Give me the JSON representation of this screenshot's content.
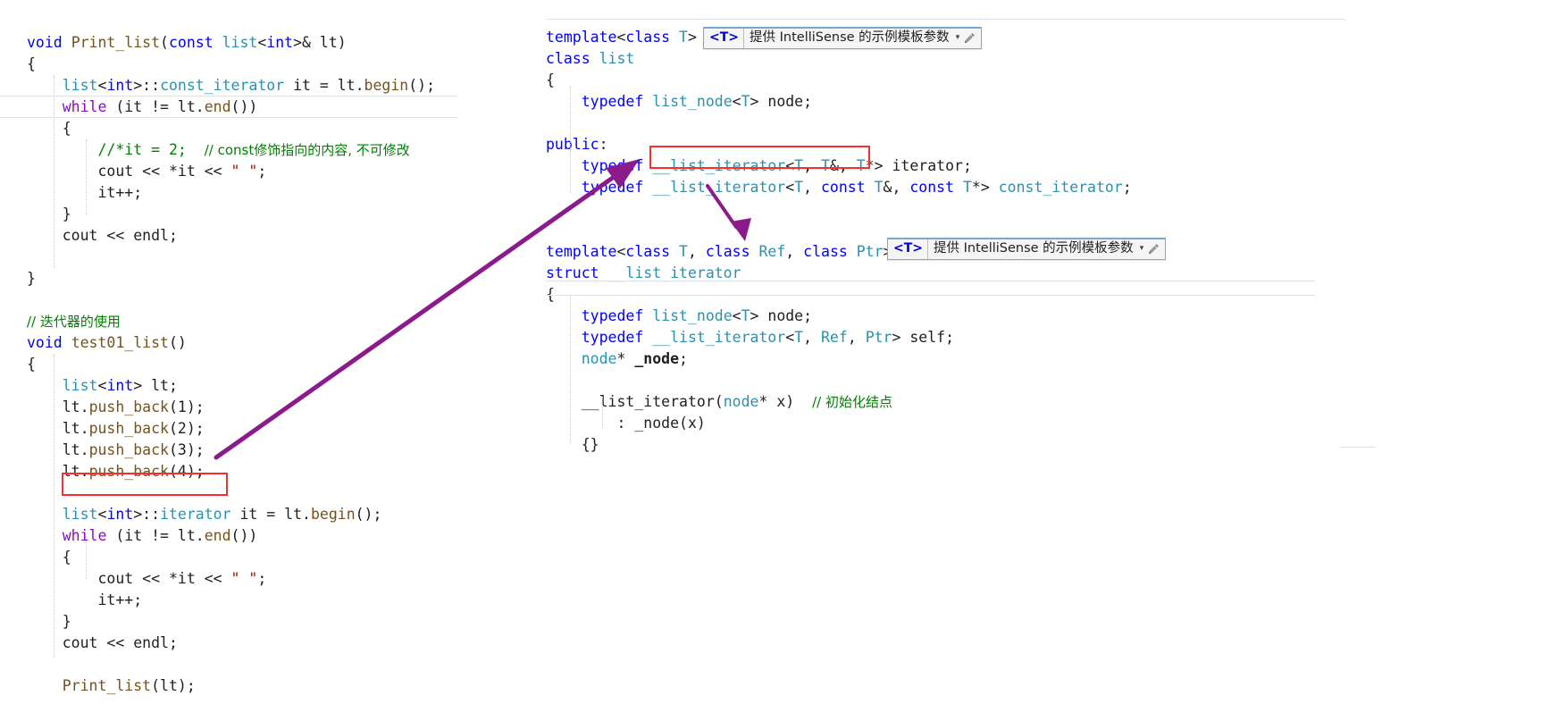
{
  "meta": {
    "accent_purple": "#8B1A8B",
    "highlight_red": "#FB2C2C",
    "keyword_blue": "#0000FF",
    "type_teal": "#2B91AF",
    "comment_green": "#008000",
    "string_red": "#A31515",
    "control_purple": "#8F08C4",
    "function_brown": "#74531F"
  },
  "left_pane": {
    "lines": [
      {
        "indent": 0,
        "tokens": [
          {
            "t": "void",
            "c": "kw"
          },
          {
            "t": " ",
            "c": "plain"
          },
          {
            "t": "Print_list",
            "c": "fn"
          },
          {
            "t": "(",
            "c": "plain"
          },
          {
            "t": "const",
            "c": "kw"
          },
          {
            "t": " ",
            "c": "plain"
          },
          {
            "t": "list",
            "c": "type"
          },
          {
            "t": "<",
            "c": "plain"
          },
          {
            "t": "int",
            "c": "kw"
          },
          {
            "t": ">& lt)",
            "c": "plain"
          }
        ]
      },
      {
        "indent": 0,
        "tokens": [
          {
            "t": "{",
            "c": "plain"
          }
        ]
      },
      {
        "indent": 1,
        "tokens": [
          {
            "t": "list",
            "c": "type"
          },
          {
            "t": "<",
            "c": "plain"
          },
          {
            "t": "int",
            "c": "kw"
          },
          {
            "t": ">::",
            "c": "plain"
          },
          {
            "t": "const_iterator",
            "c": "type"
          },
          {
            "t": " it = lt.",
            "c": "plain"
          },
          {
            "t": "begin",
            "c": "fn"
          },
          {
            "t": "();",
            "c": "plain"
          }
        ]
      },
      {
        "indent": 1,
        "tokens": [
          {
            "t": "while",
            "c": "ctrl"
          },
          {
            "t": " (it != lt.",
            "c": "plain"
          },
          {
            "t": "end",
            "c": "fn"
          },
          {
            "t": "())",
            "c": "plain"
          }
        ]
      },
      {
        "indent": 1,
        "tokens": [
          {
            "t": "{",
            "c": "plain"
          }
        ]
      },
      {
        "indent": 2,
        "tokens": [
          {
            "t": "//*it = 2;",
            "c": "cmt"
          },
          {
            "t": "  ",
            "c": "plain"
          },
          {
            "t": "// const修饰指向的内容, 不可修改",
            "c": "cmt"
          }
        ]
      },
      {
        "indent": 2,
        "tokens": [
          {
            "t": "cout",
            "c": "plain"
          },
          {
            "t": " << *it << ",
            "c": "plain"
          },
          {
            "t": "\" \"",
            "c": "str"
          },
          {
            "t": ";",
            "c": "plain"
          }
        ]
      },
      {
        "indent": 2,
        "tokens": [
          {
            "t": "it++;",
            "c": "plain"
          }
        ]
      },
      {
        "indent": 1,
        "tokens": [
          {
            "t": "}",
            "c": "plain"
          }
        ]
      },
      {
        "indent": 1,
        "tokens": [
          {
            "t": "cout << ",
            "c": "plain"
          },
          {
            "t": "endl",
            "c": "plain"
          },
          {
            "t": ";",
            "c": "plain"
          }
        ]
      },
      {
        "indent": 0,
        "tokens": [
          {
            "t": "",
            "c": "plain"
          }
        ]
      },
      {
        "indent": 0,
        "tokens": [
          {
            "t": "}",
            "c": "plain"
          }
        ]
      },
      {
        "indent": 0,
        "tokens": [
          {
            "t": "",
            "c": "plain"
          }
        ]
      },
      {
        "indent": 0,
        "tokens": [
          {
            "t": "// 迭代器的使用",
            "c": "cmt"
          }
        ]
      },
      {
        "indent": 0,
        "tokens": [
          {
            "t": "void",
            "c": "kw"
          },
          {
            "t": " ",
            "c": "plain"
          },
          {
            "t": "test01_list",
            "c": "fn"
          },
          {
            "t": "()",
            "c": "plain"
          }
        ]
      },
      {
        "indent": 0,
        "tokens": [
          {
            "t": "{",
            "c": "plain"
          }
        ]
      },
      {
        "indent": 1,
        "tokens": [
          {
            "t": "list",
            "c": "type"
          },
          {
            "t": "<",
            "c": "plain"
          },
          {
            "t": "int",
            "c": "kw"
          },
          {
            "t": "> lt;",
            "c": "plain"
          }
        ]
      },
      {
        "indent": 1,
        "tokens": [
          {
            "t": "lt.",
            "c": "plain"
          },
          {
            "t": "push_back",
            "c": "fn"
          },
          {
            "t": "(1);",
            "c": "plain"
          }
        ]
      },
      {
        "indent": 1,
        "tokens": [
          {
            "t": "lt.",
            "c": "plain"
          },
          {
            "t": "push_back",
            "c": "fn"
          },
          {
            "t": "(2);",
            "c": "plain"
          }
        ]
      },
      {
        "indent": 1,
        "tokens": [
          {
            "t": "lt.",
            "c": "plain"
          },
          {
            "t": "push_back",
            "c": "fn"
          },
          {
            "t": "(3);",
            "c": "plain"
          }
        ]
      },
      {
        "indent": 1,
        "tokens": [
          {
            "t": "lt.",
            "c": "plain"
          },
          {
            "t": "push_back",
            "c": "fn"
          },
          {
            "t": "(4);",
            "c": "plain"
          }
        ]
      },
      {
        "indent": 0,
        "tokens": [
          {
            "t": "",
            "c": "plain"
          }
        ]
      },
      {
        "indent": 1,
        "tokens": [
          {
            "t": "list",
            "c": "type"
          },
          {
            "t": "<",
            "c": "plain"
          },
          {
            "t": "int",
            "c": "kw"
          },
          {
            "t": ">::",
            "c": "plain"
          },
          {
            "t": "iterator",
            "c": "type"
          },
          {
            "t": " it = lt.",
            "c": "plain"
          },
          {
            "t": "begin",
            "c": "fn"
          },
          {
            "t": "();",
            "c": "plain"
          }
        ]
      },
      {
        "indent": 1,
        "tokens": [
          {
            "t": "while",
            "c": "ctrl"
          },
          {
            "t": " (it != lt.",
            "c": "plain"
          },
          {
            "t": "end",
            "c": "fn"
          },
          {
            "t": "())",
            "c": "plain"
          }
        ]
      },
      {
        "indent": 1,
        "tokens": [
          {
            "t": "{",
            "c": "plain"
          }
        ]
      },
      {
        "indent": 2,
        "tokens": [
          {
            "t": "cout << *it << ",
            "c": "plain"
          },
          {
            "t": "\" \"",
            "c": "str"
          },
          {
            "t": ";",
            "c": "plain"
          }
        ]
      },
      {
        "indent": 2,
        "tokens": [
          {
            "t": "it++;",
            "c": "plain"
          }
        ]
      },
      {
        "indent": 1,
        "tokens": [
          {
            "t": "}",
            "c": "plain"
          }
        ]
      },
      {
        "indent": 1,
        "tokens": [
          {
            "t": "cout << endl;",
            "c": "plain"
          }
        ]
      },
      {
        "indent": 0,
        "tokens": [
          {
            "t": "",
            "c": "plain"
          }
        ]
      },
      {
        "indent": 1,
        "tokens": [
          {
            "t": "Print_list",
            "c": "fn"
          },
          {
            "t": "(lt);",
            "c": "plain"
          }
        ]
      }
    ]
  },
  "right_pane": {
    "lines": [
      {
        "indent": 0,
        "tokens": [
          {
            "t": "template",
            "c": "kw"
          },
          {
            "t": "<",
            "c": "plain"
          },
          {
            "t": "class",
            "c": "kw"
          },
          {
            "t": " ",
            "c": "plain"
          },
          {
            "t": "T",
            "c": "tparam"
          },
          {
            "t": ">",
            "c": "plain"
          }
        ]
      },
      {
        "indent": 0,
        "tokens": [
          {
            "t": "class",
            "c": "kw"
          },
          {
            "t": " ",
            "c": "plain"
          },
          {
            "t": "list",
            "c": "type"
          }
        ]
      },
      {
        "indent": 0,
        "tokens": [
          {
            "t": "{",
            "c": "plain"
          }
        ]
      },
      {
        "indent": 1,
        "tokens": [
          {
            "t": "typedef",
            "c": "kw"
          },
          {
            "t": " ",
            "c": "plain"
          },
          {
            "t": "list_node",
            "c": "type"
          },
          {
            "t": "<",
            "c": "plain"
          },
          {
            "t": "T",
            "c": "tparam"
          },
          {
            "t": "> node;",
            "c": "plain"
          }
        ]
      },
      {
        "indent": 0,
        "tokens": [
          {
            "t": "",
            "c": "plain"
          }
        ]
      },
      {
        "indent": 0,
        "tokens": [
          {
            "t": "public",
            "c": "kw"
          },
          {
            "t": ":",
            "c": "plain"
          }
        ]
      },
      {
        "indent": 1,
        "tokens": [
          {
            "t": "typedef",
            "c": "kw"
          },
          {
            "t": " ",
            "c": "plain"
          },
          {
            "t": "__list_iterator",
            "c": "type"
          },
          {
            "t": "<",
            "c": "plain"
          },
          {
            "t": "T",
            "c": "tparam"
          },
          {
            "t": ", ",
            "c": "plain"
          },
          {
            "t": "T",
            "c": "tparam"
          },
          {
            "t": "&, ",
            "c": "plain"
          },
          {
            "t": "T",
            "c": "tparam"
          },
          {
            "t": "*> iterator;",
            "c": "plain"
          }
        ]
      },
      {
        "indent": 1,
        "tokens": [
          {
            "t": "typedef",
            "c": "kw"
          },
          {
            "t": " ",
            "c": "plain"
          },
          {
            "t": "__list_iterator",
            "c": "type"
          },
          {
            "t": "<",
            "c": "plain"
          },
          {
            "t": "T",
            "c": "tparam"
          },
          {
            "t": ", ",
            "c": "plain"
          },
          {
            "t": "const",
            "c": "kw"
          },
          {
            "t": " ",
            "c": "plain"
          },
          {
            "t": "T",
            "c": "tparam"
          },
          {
            "t": "&, ",
            "c": "plain"
          },
          {
            "t": "const",
            "c": "kw"
          },
          {
            "t": " ",
            "c": "plain"
          },
          {
            "t": "T",
            "c": "tparam"
          },
          {
            "t": "*> ",
            "c": "plain"
          },
          {
            "t": "const_iterator",
            "c": "type"
          },
          {
            "t": ";",
            "c": "plain"
          }
        ]
      },
      {
        "indent": 0,
        "tokens": [
          {
            "t": "",
            "c": "plain"
          }
        ]
      },
      {
        "indent": 0,
        "tokens": [
          {
            "t": "",
            "c": "plain"
          }
        ]
      },
      {
        "indent": 0,
        "tokens": [
          {
            "t": "template",
            "c": "kw"
          },
          {
            "t": "<",
            "c": "plain"
          },
          {
            "t": "class",
            "c": "kw"
          },
          {
            "t": " ",
            "c": "plain"
          },
          {
            "t": "T",
            "c": "tparam"
          },
          {
            "t": ", ",
            "c": "plain"
          },
          {
            "t": "class",
            "c": "kw"
          },
          {
            "t": " ",
            "c": "plain"
          },
          {
            "t": "Ref",
            "c": "tparam"
          },
          {
            "t": ", ",
            "c": "plain"
          },
          {
            "t": "class",
            "c": "kw"
          },
          {
            "t": " ",
            "c": "plain"
          },
          {
            "t": "Ptr",
            "c": "tparam"
          },
          {
            "t": ">",
            "c": "plain"
          }
        ]
      },
      {
        "indent": 0,
        "tokens": [
          {
            "t": "struct",
            "c": "kw"
          },
          {
            "t": " ",
            "c": "plain"
          },
          {
            "t": "__list_iterator",
            "c": "type"
          }
        ]
      },
      {
        "indent": 0,
        "tokens": [
          {
            "t": "{",
            "c": "plain"
          }
        ]
      },
      {
        "indent": 1,
        "tokens": [
          {
            "t": "typedef",
            "c": "kw"
          },
          {
            "t": " ",
            "c": "plain"
          },
          {
            "t": "list_node",
            "c": "type"
          },
          {
            "t": "<",
            "c": "plain"
          },
          {
            "t": "T",
            "c": "tparam"
          },
          {
            "t": "> node;",
            "c": "plain"
          }
        ]
      },
      {
        "indent": 1,
        "tokens": [
          {
            "t": "typedef",
            "c": "kw"
          },
          {
            "t": " ",
            "c": "plain"
          },
          {
            "t": "__list_iterator",
            "c": "type"
          },
          {
            "t": "<",
            "c": "plain"
          },
          {
            "t": "T",
            "c": "tparam"
          },
          {
            "t": ", ",
            "c": "plain"
          },
          {
            "t": "Ref",
            "c": "tparam"
          },
          {
            "t": ", ",
            "c": "plain"
          },
          {
            "t": "Ptr",
            "c": "tparam"
          },
          {
            "t": "> self;",
            "c": "plain"
          }
        ]
      },
      {
        "indent": 1,
        "tokens": [
          {
            "t": "node",
            "c": "type"
          },
          {
            "t": "* ",
            "c": "plain"
          },
          {
            "t": "_node",
            "c": "plain bold"
          },
          {
            "t": ";",
            "c": "plain"
          }
        ]
      },
      {
        "indent": 0,
        "tokens": [
          {
            "t": "",
            "c": "plain"
          }
        ]
      },
      {
        "indent": 1,
        "tokens": [
          {
            "t": "__list_iterator",
            "c": "plain"
          },
          {
            "t": "(",
            "c": "plain"
          },
          {
            "t": "node",
            "c": "type"
          },
          {
            "t": "* x)",
            "c": "plain"
          },
          {
            "t": "  ",
            "c": "plain"
          },
          {
            "t": "// 初始化结点",
            "c": "cmt"
          }
        ]
      },
      {
        "indent": 2,
        "tokens": [
          {
            "t": ": _node(x)",
            "c": "plain"
          }
        ]
      },
      {
        "indent": 1,
        "tokens": [
          {
            "t": "{}",
            "c": "plain"
          }
        ]
      }
    ]
  },
  "intellisense_badges": [
    {
      "slot_label": "<T>",
      "text": "提供 IntelliSense 的示例模板参数",
      "caret": "▾",
      "pencil_icon": "pencil-icon"
    },
    {
      "slot_label": "<T>",
      "text": "提供 IntelliSense 的示例模板参数",
      "caret": "▾",
      "pencil_icon": "pencil-icon"
    }
  ],
  "annotations": {
    "red_boxes": [
      {
        "label": "list<int>::iterator"
      },
      {
        "label": "__list_iterator<T, T&, T*>"
      }
    ],
    "arrows": [
      {
        "label": "long-diagonal-arrow-to-typedef-iterator"
      },
      {
        "label": "short-arrow-to-struct-template"
      }
    ]
  }
}
